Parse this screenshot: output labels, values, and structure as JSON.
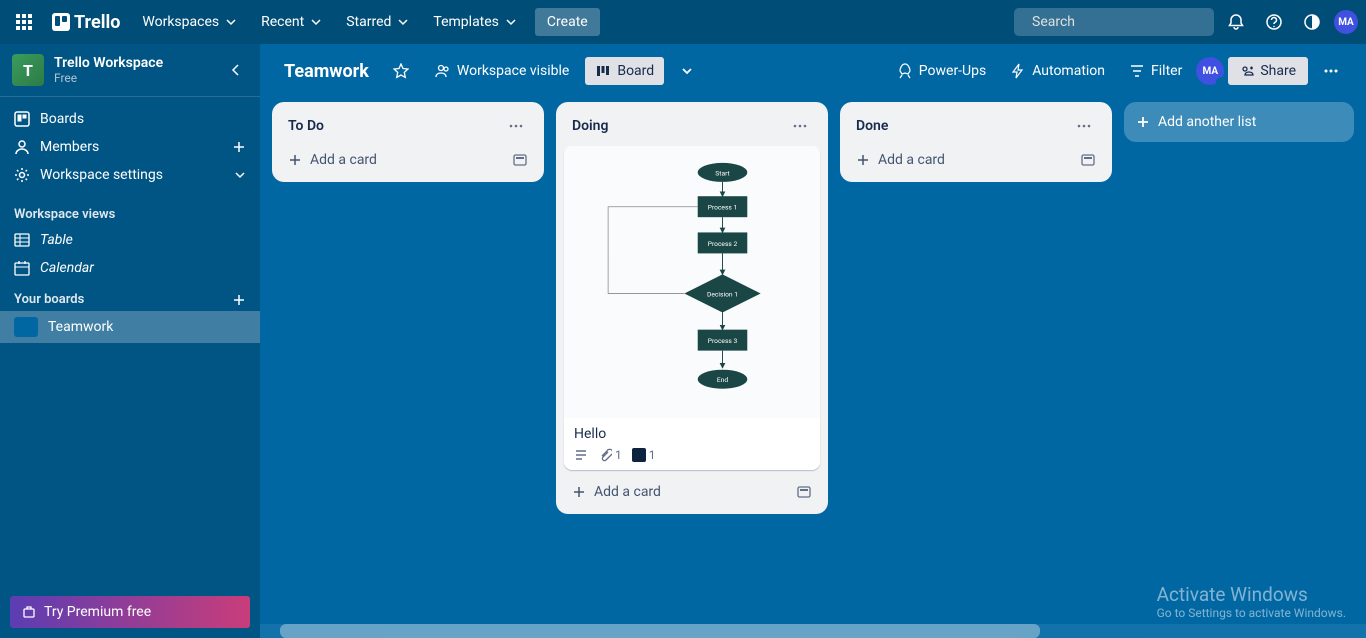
{
  "topnav": {
    "logo": "Trello",
    "menus": [
      "Workspaces",
      "Recent",
      "Starred",
      "Templates"
    ],
    "create": "Create",
    "search_placeholder": "Search",
    "avatar_initials": "MA"
  },
  "sidebar": {
    "workspace_initial": "T",
    "workspace_name": "Trello Workspace",
    "workspace_plan": "Free",
    "items": [
      {
        "icon": "board",
        "label": "Boards"
      },
      {
        "icon": "members",
        "label": "Members",
        "trail": "+"
      },
      {
        "icon": "gear",
        "label": "Workspace settings",
        "trail": "chevron"
      }
    ],
    "views_heading": "Workspace views",
    "views": [
      {
        "icon": "table",
        "label": "Table"
      },
      {
        "icon": "calendar",
        "label": "Calendar"
      }
    ],
    "boards_heading": "Your boards",
    "boards": [
      {
        "label": "Teamwork",
        "active": true
      }
    ],
    "premium": "Try Premium free"
  },
  "board_header": {
    "title": "Teamwork",
    "visibility": "Workspace visible",
    "view_label": "Board",
    "powerups": "Power-Ups",
    "automation": "Automation",
    "filter": "Filter",
    "share": "Share",
    "avatar_initials": "MA"
  },
  "lists": [
    {
      "title": "To Do",
      "cards": [],
      "add_label": "Add a card"
    },
    {
      "title": "Doing",
      "add_label": "Add a card",
      "cards": [
        {
          "title": "Hello",
          "has_description": true,
          "attachments": 1,
          "cover_count": 1,
          "flowchart": {
            "nodes": [
              "Start",
              "Process 1",
              "Process 2",
              "Decision 1",
              "Process 3",
              "End"
            ]
          }
        }
      ]
    },
    {
      "title": "Done",
      "cards": [],
      "add_label": "Add a card"
    }
  ],
  "add_list_label": "Add another list",
  "watermark": {
    "title": "Activate Windows",
    "sub": "Go to Settings to activate Windows."
  }
}
